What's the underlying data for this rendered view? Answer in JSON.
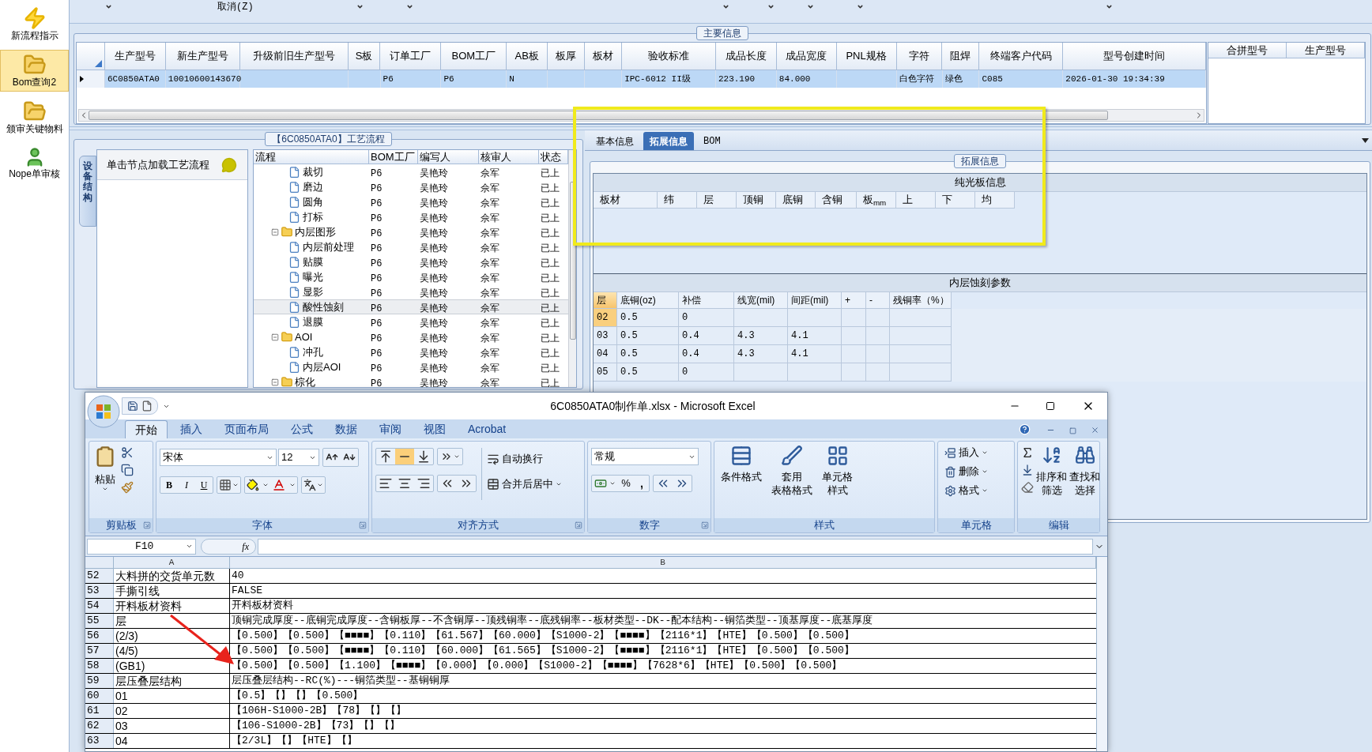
{
  "sidebar": {
    "items": [
      {
        "label": "新流程指示",
        "selected": false
      },
      {
        "label": "Bom查询2",
        "selected": true
      },
      {
        "label": "颁审关键物料",
        "selected": false
      },
      {
        "label": "Nope单审核",
        "selected": false
      }
    ]
  },
  "toolbar": {
    "cancel_button": "取消(Z)"
  },
  "main_info": {
    "title": "主要信息",
    "columns": [
      "生产型号",
      "新生产型号",
      "升级前旧生产型号",
      "S板",
      "订单工厂",
      "BOM工厂",
      "AB板",
      "板厚",
      "板材",
      "验收标准",
      "成品长度",
      "成品宽度",
      "PNL规格",
      "字符",
      "阻焊",
      "终端客户代码",
      "型号创建时间"
    ],
    "rows": [
      {
        "selected": true,
        "cells": [
          "6C0850ATA0",
          "10010600143670",
          null,
          null,
          "P6",
          "P6",
          "N",
          null,
          null,
          "IPC-6012 II级",
          "223.190",
          "84.000",
          null,
          "白色字符",
          "绿色",
          "C085",
          "2026-01-30 19:34:39"
        ]
      }
    ],
    "merge_columns": [
      "合拼型号",
      "生产型号"
    ]
  },
  "process_flow": {
    "title": "【6C0850ATA0】工艺流程",
    "side_tab": "设备结构",
    "hint": "单击节点加载工艺流程",
    "columns": [
      "流程",
      "BOM工厂",
      "编写人",
      "核审人",
      "状态"
    ],
    "tree": [
      {
        "kind": "file",
        "label": "裁切",
        "cells": [
          "P6",
          "吴艳玲",
          "佘军",
          "已上"
        ],
        "selected": false
      },
      {
        "kind": "file",
        "label": "磨边",
        "cells": [
          "P6",
          "吴艳玲",
          "佘军",
          "已上"
        ],
        "selected": false
      },
      {
        "kind": "file",
        "label": "圆角",
        "cells": [
          "P6",
          "吴艳玲",
          "佘军",
          "已上"
        ],
        "selected": false
      },
      {
        "kind": "file",
        "label": "打标",
        "cells": [
          "P6",
          "吴艳玲",
          "佘军",
          "已上"
        ],
        "selected": false
      },
      {
        "kind": "folder",
        "label": "内层图形",
        "cells": [
          "P6",
          "吴艳玲",
          "佘军",
          "已上"
        ],
        "selected": false,
        "expanded": true,
        "children": [
          {
            "kind": "file",
            "label": "内层前处理",
            "cells": [
              "P6",
              "吴艳玲",
              "佘军",
              "已上"
            ],
            "selected": false
          },
          {
            "kind": "file",
            "label": "贴膜",
            "cells": [
              "P6",
              "吴艳玲",
              "佘军",
              "已上"
            ],
            "selected": false
          },
          {
            "kind": "file",
            "label": "曝光",
            "cells": [
              "P6",
              "吴艳玲",
              "佘军",
              "已上"
            ],
            "selected": false
          },
          {
            "kind": "file",
            "label": "显影",
            "cells": [
              "P6",
              "吴艳玲",
              "佘军",
              "已上"
            ],
            "selected": false
          },
          {
            "kind": "file",
            "label": "酸性蚀刻",
            "cells": [
              "P6",
              "吴艳玲",
              "佘军",
              "已上"
            ],
            "selected": true
          },
          {
            "kind": "file",
            "label": "退膜",
            "cells": [
              "P6",
              "吴艳玲",
              "佘军",
              "已上"
            ],
            "selected": false
          }
        ]
      },
      {
        "kind": "folder",
        "label": "AOI",
        "cells": [
          "P6",
          "吴艳玲",
          "佘军",
          "已上"
        ],
        "selected": false,
        "expanded": true,
        "children": [
          {
            "kind": "file",
            "label": "冲孔",
            "cells": [
              "P6",
              "吴艳玲",
              "佘军",
              "已上"
            ],
            "selected": false
          },
          {
            "kind": "file",
            "label": "内层AOI",
            "cells": [
              "P6",
              "吴艳玲",
              "佘军",
              "已上"
            ],
            "selected": false
          }
        ]
      },
      {
        "kind": "folder",
        "label": "棕化",
        "cells": [
          "P6",
          "吴艳玲",
          "佘军",
          "已上"
        ],
        "selected": false,
        "expanded": true
      }
    ]
  },
  "detail": {
    "tabs": [
      {
        "label": "基本信息",
        "selected": false
      },
      {
        "label": "拓展信息",
        "selected": true
      },
      {
        "label": "BOM",
        "selected": false
      }
    ],
    "group_title": "拓展信息",
    "bare_board": {
      "title": "纯光板信息",
      "columns": [
        "板材",
        "纬",
        "层",
        "顶铜",
        "底铜",
        "含铜",
        "板$_{mm}$",
        "上",
        "下",
        "均"
      ]
    },
    "etch": {
      "title": "内层蚀刻参数",
      "columns": [
        "层",
        "底铜(oz)",
        "补偿",
        "线宽(mil)",
        "间距(mil)",
        "+",
        "-",
        "残铜率（%）"
      ],
      "rows": [
        {
          "selected": true,
          "cells": [
            "02",
            "0.5",
            "0",
            null,
            null,
            null,
            null,
            null
          ]
        },
        {
          "selected": false,
          "cells": [
            "03",
            "0.5",
            "0.4",
            "4.3",
            "4.1",
            null,
            null,
            null
          ]
        },
        {
          "selected": false,
          "cells": [
            "04",
            "0.5",
            "0.4",
            "4.3",
            "4.1",
            null,
            null,
            null
          ]
        },
        {
          "selected": false,
          "cells": [
            "05",
            "0.5",
            "0",
            null,
            null,
            null,
            null,
            null
          ]
        }
      ]
    }
  },
  "excel": {
    "title": "6C0850ATA0制作单.xlsx - Microsoft Excel",
    "ribbon_tabs": [
      {
        "label": "开始",
        "selected": true
      },
      {
        "label": "插入",
        "selected": false
      },
      {
        "label": "页面布局",
        "selected": false
      },
      {
        "label": "公式",
        "selected": false
      },
      {
        "label": "数据",
        "selected": false
      },
      {
        "label": "审阅",
        "selected": false
      },
      {
        "label": "视图",
        "selected": false
      },
      {
        "label": "Acrobat",
        "selected": false
      }
    ],
    "groups": [
      {
        "kind": "clipboard",
        "label": "剪贴板",
        "paste": "粘贴"
      },
      {
        "kind": "font",
        "label": "字体",
        "font_name": "宋体",
        "font_size": "12",
        "bold": "B",
        "italic": "I",
        "underline": "U"
      },
      {
        "kind": "alignment",
        "label": "对齐方式",
        "vertical_align": [
          {
            "selected": false
          },
          {
            "selected": true
          },
          {
            "selected": false
          }
        ],
        "wrap": "自动换行",
        "merge": "合并后居中"
      },
      {
        "kind": "number",
        "label": "数字",
        "format": "常规",
        "percent": "%",
        "comma": ","
      },
      {
        "kind": "styles",
        "label": "样式",
        "buttons": [
          {
            "lines": [
              "条件格式"
            ]
          },
          {
            "lines": [
              "套用",
              "表格格式"
            ]
          },
          {
            "lines": [
              "单元格",
              "样式"
            ]
          }
        ]
      },
      {
        "kind": "cells",
        "label": "单元格",
        "buttons": [
          "插入",
          "删除",
          "格式"
        ]
      },
      {
        "kind": "editing",
        "label": "编辑",
        "buttons": [
          {
            "lines": [
              "排序和",
              "筛选"
            ]
          },
          {
            "lines": [
              "查找和",
              "选择"
            ]
          }
        ]
      }
    ],
    "cell_ref": "F10",
    "fx": "fx",
    "columns": [
      "A",
      "B"
    ],
    "rows": [
      {
        "number": "52",
        "a": "大料拼的交货单元数",
        "b": "40"
      },
      {
        "number": "53",
        "a": "手撕引线",
        "b": "FALSE"
      },
      {
        "number": "54",
        "a": "开料板材资料",
        "b": "开料板材资料"
      },
      {
        "number": "55",
        "a": "层",
        "b": "顶铜完成厚度--底铜完成厚度--含铜板厚--不含铜厚--顶残铜率--底残铜率--板材类型--DK--配本结构--铜箔类型--顶基厚度--底基厚度"
      },
      {
        "number": "56",
        "a": "(2/3)",
        "b": "【0.500】【0.500】【■■■■】【0.110】【61.567】【60.000】【S1000-2】【■■■■】【2116*1】【HTE】【0.500】【0.500】"
      },
      {
        "number": "57",
        "a": "(4/5)",
        "b": "【0.500】【0.500】【■■■■】【0.110】【60.000】【61.565】【S1000-2】【■■■■】【2116*1】【HTE】【0.500】【0.500】"
      },
      {
        "number": "58",
        "a": "(GB1)",
        "b": "【0.500】【0.500】【1.100】【■■■■】【0.000】【0.000】【S1000-2】【■■■■】【7628*6】【HTE】【0.500】【0.500】"
      },
      {
        "number": "59",
        "a": "层压叠层结构",
        "b": "层压叠层结构--RC(%)---铜箔类型--基铜铜厚"
      },
      {
        "number": "60",
        "a": "01",
        "b": "【0.5】【】【】【0.500】"
      },
      {
        "number": "61",
        "a": "02",
        "b": "【106H-S1000-2B】【78】【】【】"
      },
      {
        "number": "62",
        "a": "03",
        "b": "【106-S1000-2B】【73】【】【】"
      },
      {
        "number": "63",
        "a": "04",
        "b": "【2/3L】【】【HTE】【】"
      }
    ]
  }
}
